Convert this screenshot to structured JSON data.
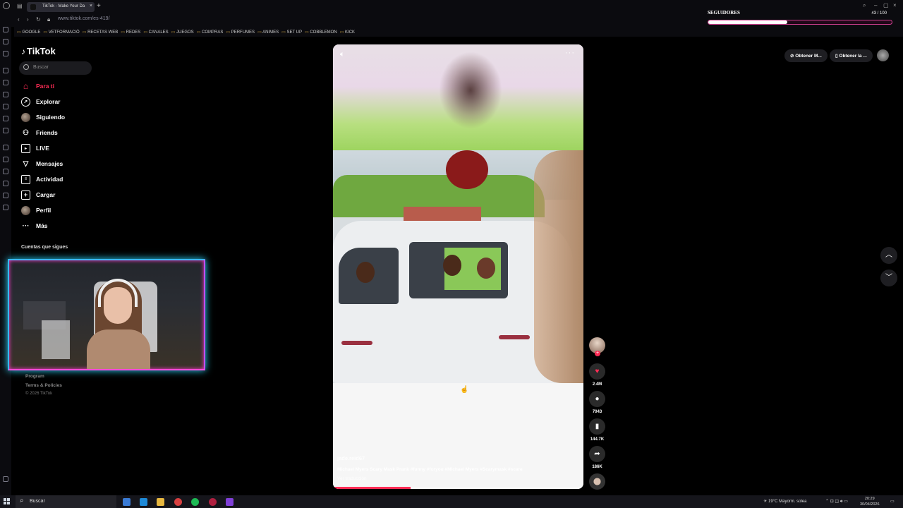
{
  "browser": {
    "tab_title": "TikTok - Make Your Da",
    "url": "www.tiktok.com/es-419/",
    "bookmarks": [
      "GOOGLE",
      "VETFORMACIÓ",
      "RECETAS WEB",
      "REDES",
      "CANALES",
      "JUEGOS",
      "COMPRAS",
      "PERFUMES",
      "ANIMES",
      "SET UP",
      "COBBLEMON",
      "KICK"
    ]
  },
  "followers_widget": {
    "title": "SEGUIDORES",
    "count": "43 / 100",
    "progress": 0.43
  },
  "sidebar": {
    "logo": "TikTok",
    "search_placeholder": "Buscar",
    "items": [
      {
        "label": "Para ti",
        "icon": "home-icon"
      },
      {
        "label": "Explorar",
        "icon": "compass-icon"
      },
      {
        "label": "Siguiendo",
        "icon": "following-avatar-icon"
      },
      {
        "label": "Friends",
        "icon": "friends-icon"
      },
      {
        "label": "LIVE",
        "icon": "live-icon"
      },
      {
        "label": "Mensajes",
        "icon": "send-icon"
      },
      {
        "label": "Actividad",
        "icon": "activity-icon"
      },
      {
        "label": "Cargar",
        "icon": "upload-icon"
      },
      {
        "label": "Perfil",
        "icon": "profile-icon"
      },
      {
        "label": "Más",
        "icon": "more-icon"
      }
    ],
    "following_title": "Cuentas que sigues",
    "footer": {
      "program": "Program",
      "terms": "Terms & Policies",
      "copyright": "© 2026 TikTok"
    }
  },
  "header": {
    "btn1": "Obtener M...",
    "btn2": "Obtener la ..."
  },
  "video": {
    "username": "jade.reid67",
    "description": "Michael Myers Scary Mask Prank #funny #foryou #Michael Myers #Scarymask #scare",
    "translate": "Ver traducción",
    "progress": 0.31
  },
  "actions": {
    "likes": "2.4M",
    "comments": "7043",
    "saves": "144.7K",
    "shares": "186K"
  },
  "taskbar": {
    "search_placeholder": "Buscar",
    "weather": "19°C  Mayorm. solea",
    "time": "20:29",
    "date": "30/04/2026"
  }
}
